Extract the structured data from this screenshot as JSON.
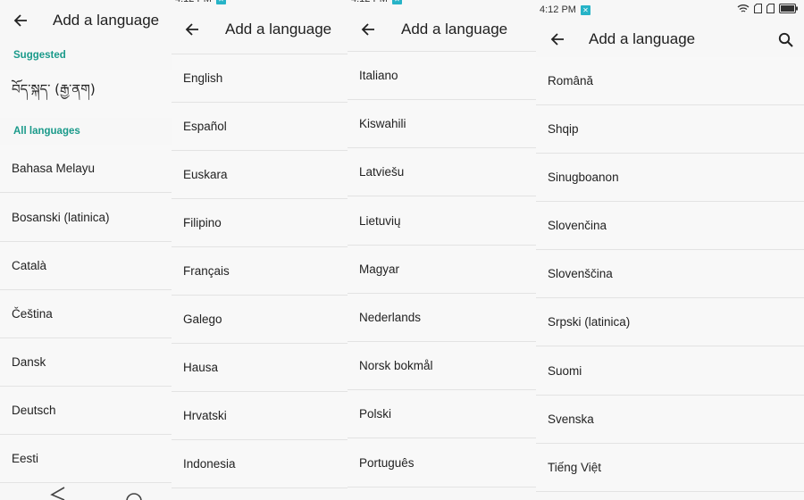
{
  "screen_title": "Add a language",
  "status_time": "4:12 PM",
  "panel1": {
    "suggested_header": "Suggested",
    "suggested": [
      "བོད་སྐད་ (རྒྱ་ནག)"
    ],
    "all_header": "All languages",
    "items": [
      "Bahasa Melayu",
      "Bosanski (latinica)",
      "Català",
      "Čeština",
      "Dansk",
      "Deutsch",
      "Eesti"
    ]
  },
  "panel2": {
    "items": [
      "English",
      "Español",
      "Euskara",
      "Filipino",
      "Français",
      "Galego",
      "Hausa",
      "Hrvatski",
      "Indonesia"
    ]
  },
  "panel3": {
    "items": [
      "Italiano",
      "Kiswahili",
      "Latviešu",
      "Lietuvių",
      "Magyar",
      "Nederlands",
      "Norsk bokmål",
      "Polski",
      "Português"
    ]
  },
  "panel4": {
    "items": [
      "Română",
      "Shqip",
      "Sinugboanon",
      "Slovenčina",
      "Slovenščina",
      "Srpski (latinica)",
      "Suomi",
      "Svenska",
      "Tiếng Việt"
    ]
  },
  "icons": {
    "back": "arrow-left-icon",
    "search": "search-icon",
    "wifi": "wifi-icon",
    "sim": "sim-card-icon",
    "battery": "battery-icon",
    "notification": "notification-icon"
  },
  "colors": {
    "accent": "#1a9a8a",
    "notification_badge": "#26b3c7"
  }
}
